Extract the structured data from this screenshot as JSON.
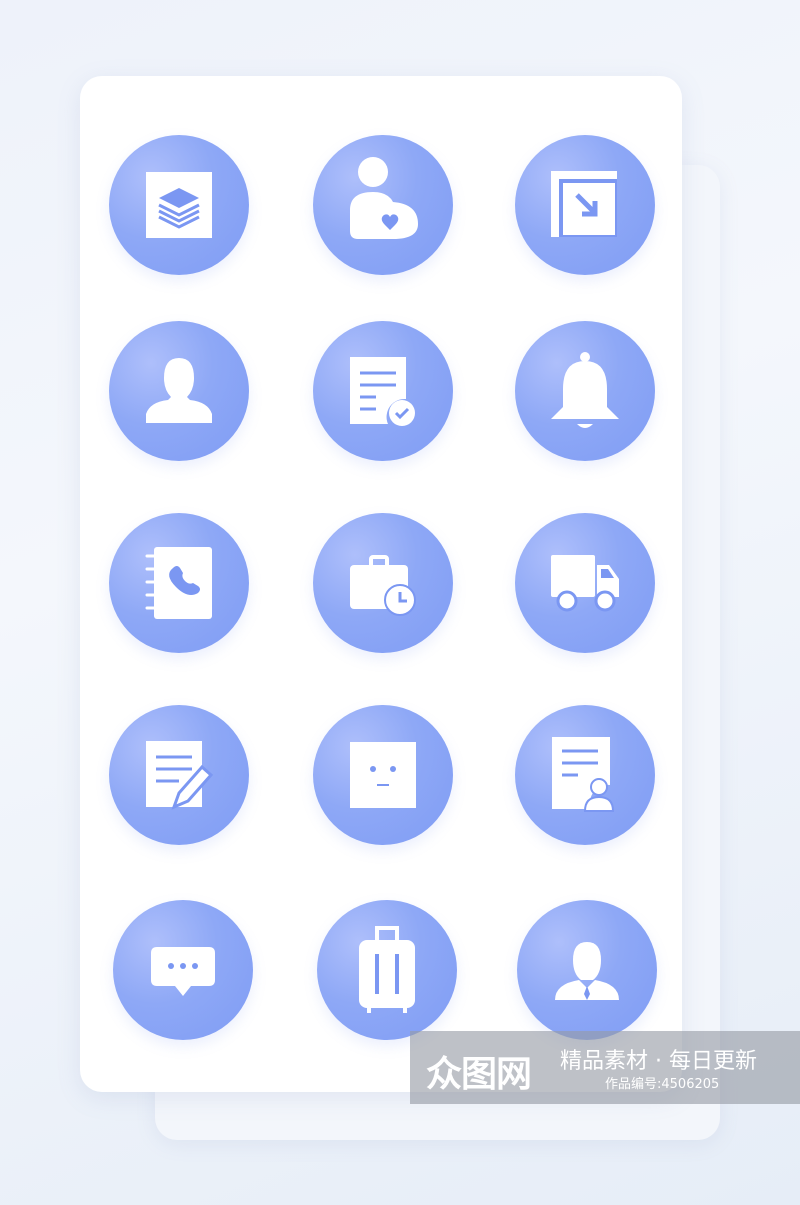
{
  "colors": {
    "circle": "#8ea8f6",
    "icon": "#ffffff",
    "accent": "#7b97f2"
  },
  "icons": [
    "layers-icon",
    "user-heart-icon",
    "arrow-in-box-icon",
    "user-icon",
    "document-check-icon",
    "bell-icon",
    "phonebook-icon",
    "briefcase-clock-icon",
    "truck-icon",
    "note-edit-icon",
    "face-icon",
    "document-user-icon",
    "chat-icon",
    "luggage-icon",
    "businessman-icon"
  ],
  "watermark": {
    "logo": "众图网",
    "slogan": "精品素材 · 每日更新",
    "code": "作品编号:4506205"
  }
}
